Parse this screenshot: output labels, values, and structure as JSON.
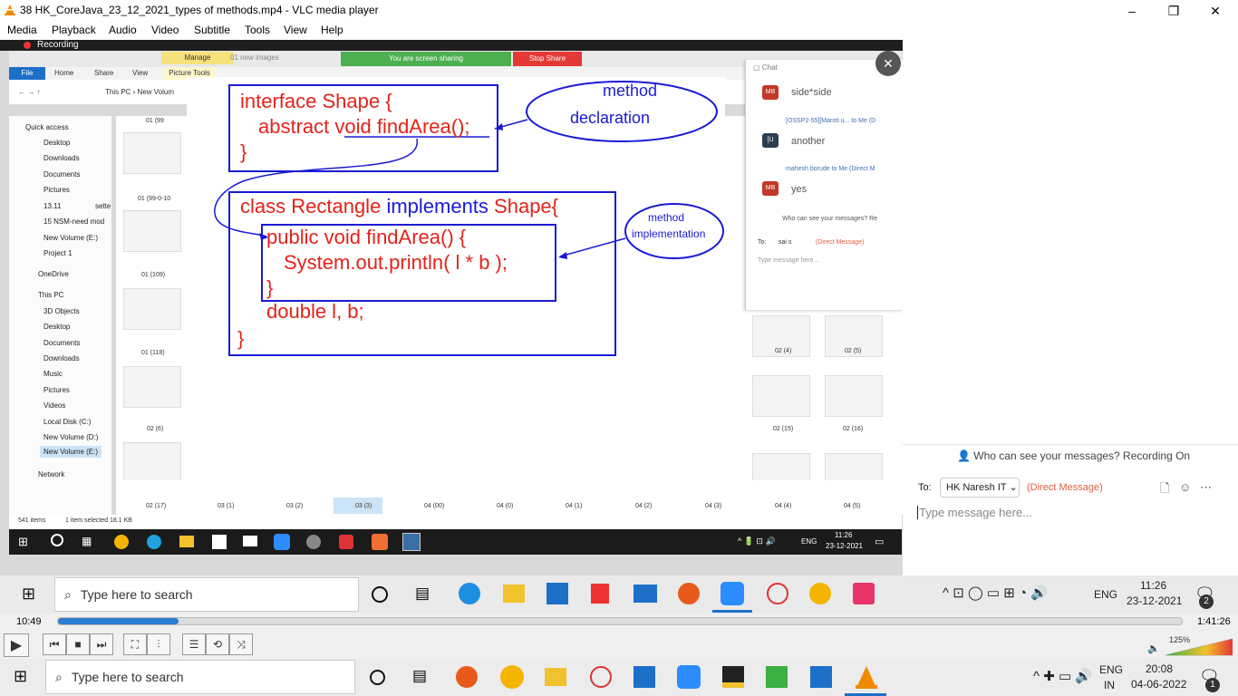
{
  "window": {
    "title": "38 HK_CoreJava_23_12_2021_types of methods.mp4 - VLC media player",
    "min": "–",
    "max": "❐",
    "close": "✕"
  },
  "menu": [
    "Media",
    "Playback",
    "Audio",
    "Video",
    "Subtitle",
    "Tools",
    "View",
    "Help"
  ],
  "recording": {
    "label": "Recording",
    "ribbon_manage": "Manage",
    "ribbon_new_images": "01 new images",
    "sharing": "You are screen sharing",
    "stop_share": "Stop Share",
    "file_tab": "File",
    "home_tab": "Home",
    "share_tab": "Share",
    "view_tab": "View",
    "picture_tools": "Picture Tools",
    "address": "This PC  ›  New Volum"
  },
  "explorer": {
    "sidebar": [
      "Quick access",
      "Desktop",
      "Downloads",
      "Documents",
      "Pictures",
      "13.11",
      "15 NSM-need mod",
      "New Volume (E:)",
      "Project 1",
      "OneDrive",
      "This PC",
      "3D Objects",
      "Desktop",
      "Documents",
      "Downloads",
      "Music",
      "Pictures",
      "Videos",
      "Local Disk (C:)",
      "New Volume (D:)",
      "New Volume (E:)",
      "Network"
    ],
    "sette": "sette",
    "left_labels": [
      "01 (99",
      "01 (99-0-10",
      "01 (109)",
      "01 (118)",
      "02 (6)"
    ],
    "bottom_labels": [
      "02 (17)",
      "03 (1)",
      "03 (2)",
      "03 (3)",
      "04 (00)",
      "04 (0)",
      "04 (1)",
      "04 (2)",
      "04 (3)",
      "04 (4)",
      "04 (5)"
    ],
    "right_labels": [
      "02 (4)",
      "02 (5)",
      "02 (15)",
      "02 (16)"
    ],
    "status_items": "541 items",
    "status_selected": "1 item selected  18.1 KB"
  },
  "slide": {
    "interface_line1": "interface Shape {",
    "interface_line2": "abstract void findArea();",
    "close1": "}",
    "class_red1": "class Rectangle",
    "class_blue": "implements",
    "class_red2": "Shape{",
    "method_line": "public void findArea() {",
    "print_line": "System.out.println( l * b );",
    "close2": "}",
    "double_line": "double l, b;",
    "close3": "}",
    "bubble1_line1": "method",
    "bubble1_line2": "declaration",
    "bubble2_line1": "method",
    "bubble2_line2": "implementation"
  },
  "inner_chat": {
    "title": "Chat",
    "msgs": [
      {
        "avatar": "MB",
        "text": "side*side"
      },
      {
        "from": "[OSSP2-55][Maroti u...  to Me (D",
        "avatar": "[U",
        "text": "another"
      },
      {
        "from": "mahesh borude to Me (Direct M",
        "avatar": "MB",
        "text": "yes"
      }
    ],
    "who": "Who can see your messages? Re",
    "to_label": "To:",
    "to_value": "sai s",
    "dm": "(Direct Message)",
    "placeholder": "Type message here..."
  },
  "inner_taskbar": {
    "time": "11:26",
    "date": "23-12-2021",
    "lang": "ENG"
  },
  "outer_chat": {
    "who": "Who can see your messages? Recording On",
    "to_label": "To:",
    "to_value": "HK Naresh IT",
    "dm": "(Direct Message)",
    "placeholder": "Type message here..."
  },
  "taskbar_mid": {
    "search": "Type here to search",
    "lang": "ENG",
    "time": "11:26",
    "date": "23-12-2021",
    "badge": "2"
  },
  "player": {
    "elapsed": "10:49",
    "total": "1:41:26",
    "progress": 0.107,
    "volume_label": "125%",
    "volume": 1.0
  },
  "taskbar_bottom": {
    "search": "Type here to search",
    "lang1": "ENG",
    "lang2": "IN",
    "time": "20:08",
    "date": "04-06-2022",
    "badge": "1"
  }
}
